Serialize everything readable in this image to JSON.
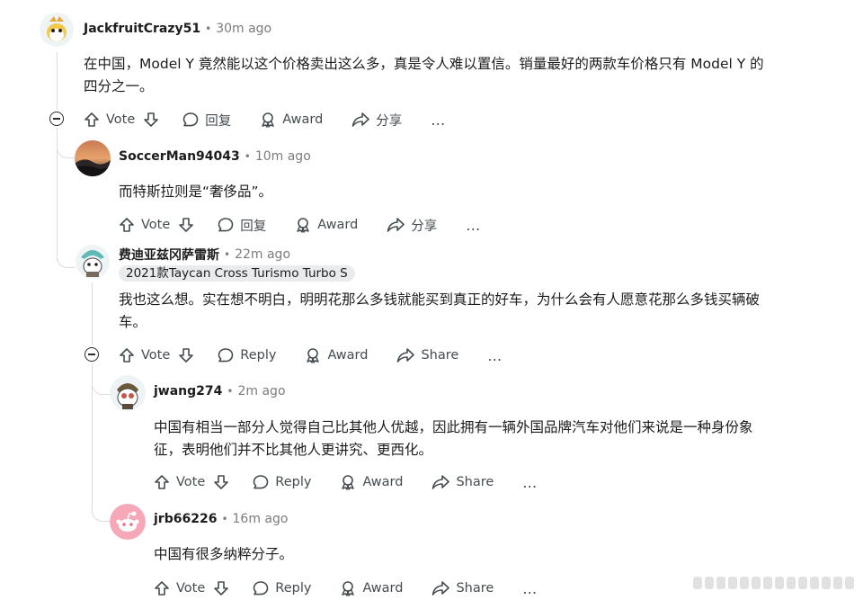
{
  "comments": [
    {
      "username": "JackfruitCrazy51",
      "time": "30m ago",
      "text_lines": [
        "在中国，Model Y 竟然能以这个价格卖出这么多，真是令人难以置信。销量最好的两款车价格只有 Model Y 的",
        "四分之一。"
      ],
      "actions": {
        "vote": "Vote",
        "reply": "回复",
        "award": "Award",
        "share": "分享"
      }
    },
    {
      "username": "SoccerMan94043",
      "time": "10m ago",
      "text_lines": [
        "而特斯拉则是“奢侈品”。"
      ],
      "actions": {
        "vote": "Vote",
        "reply": "回复",
        "award": "Award",
        "share": "分享"
      }
    },
    {
      "username": "费迪亚兹冈萨雷斯",
      "time": "22m ago",
      "flair": "2021款Taycan Cross Turismo Turbo S",
      "text_lines": [
        "我也这么想。实在想不明白，明明花那么多钱就能买到真正的好车，为什么会有人愿意花那么多钱买辆破",
        "车。"
      ],
      "actions": {
        "vote": "Vote",
        "reply": "Reply",
        "award": "Award",
        "share": "Share"
      }
    },
    {
      "username": "jwang274",
      "time": "2m ago",
      "text_lines": [
        "中国有相当一部分人觉得自己比其他人优越，因此拥有一辆外国品牌汽车对他们来说是一种身份象",
        "征，表明他们并不比其他人更讲究、更西化。"
      ],
      "actions": {
        "vote": "Vote",
        "reply": "Reply",
        "award": "Award",
        "share": "Share"
      }
    },
    {
      "username": "jrb66226",
      "time": "16m ago",
      "text_lines": [
        "中国有很多纳粹分子。"
      ],
      "actions": {
        "vote": "Vote",
        "reply": "Reply",
        "award": "Award",
        "share": "Share"
      }
    }
  ],
  "more_icon": "…",
  "colors": {
    "text": "#1c1c1c",
    "meta": "#7c7c7c",
    "action": "#444c50",
    "thread": "#dcdcdc",
    "flair_bg": "#e9ebed"
  }
}
